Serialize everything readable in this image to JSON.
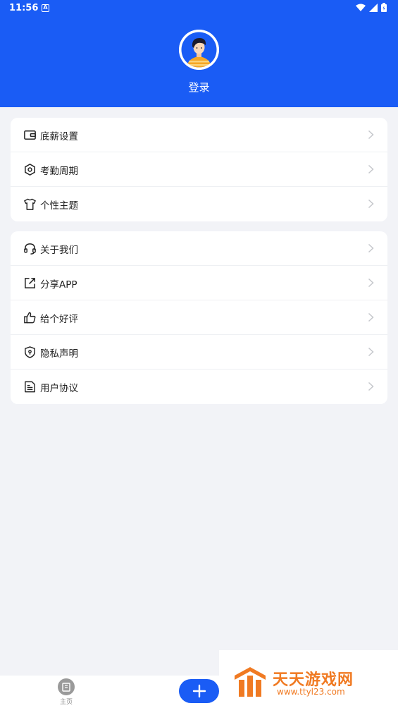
{
  "status_bar": {
    "time": "11:56",
    "app_icon_letter": "A"
  },
  "profile": {
    "login_label": "登录"
  },
  "menu_group_1": [
    {
      "label": "底薪设置",
      "icon": "wallet-icon"
    },
    {
      "label": "考勤周期",
      "icon": "hexagon-settings-icon"
    },
    {
      "label": "个性主题",
      "icon": "tshirt-icon"
    }
  ],
  "menu_group_2": [
    {
      "label": "关于我们",
      "icon": "headset-icon"
    },
    {
      "label": "分享APP",
      "icon": "share-icon"
    },
    {
      "label": "给个好评",
      "icon": "thumbs-up-icon"
    },
    {
      "label": "隐私声明",
      "icon": "shield-lock-icon"
    },
    {
      "label": "用户协议",
      "icon": "document-icon"
    }
  ],
  "bottom_nav": {
    "home_label": "主页"
  },
  "watermark": {
    "title": "天天游戏网",
    "url": "www.ttyl23.com"
  },
  "colors": {
    "primary": "#1a5cf5",
    "background": "#f2f3f7",
    "watermark": "#f07a22"
  }
}
